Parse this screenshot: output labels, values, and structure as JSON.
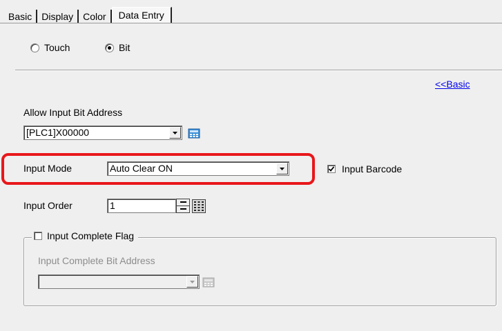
{
  "tabs": [
    {
      "label": "Basic"
    },
    {
      "label": "Display"
    },
    {
      "label": "Color"
    },
    {
      "label": "Data Entry"
    }
  ],
  "input_type": {
    "options": [
      {
        "label": "Touch",
        "checked": false
      },
      {
        "label": "Bit",
        "checked": true
      }
    ]
  },
  "basic_link": "<<Basic",
  "allow_input": {
    "label": "Allow Input Bit Address",
    "value": "[PLC1]X00000"
  },
  "input_mode": {
    "label": "Input Mode",
    "value": "Auto Clear ON"
  },
  "barcode": {
    "label": "Input Barcode",
    "checked": true
  },
  "input_order": {
    "label": "Input Order",
    "value": "1"
  },
  "complete_flag": {
    "label": "Input Complete Flag",
    "checked": false,
    "address_label": "Input Complete Bit Address",
    "address_value": ""
  },
  "colors": {
    "highlight": "#e8171b",
    "link": "#0000ee",
    "background": "#efefef"
  }
}
